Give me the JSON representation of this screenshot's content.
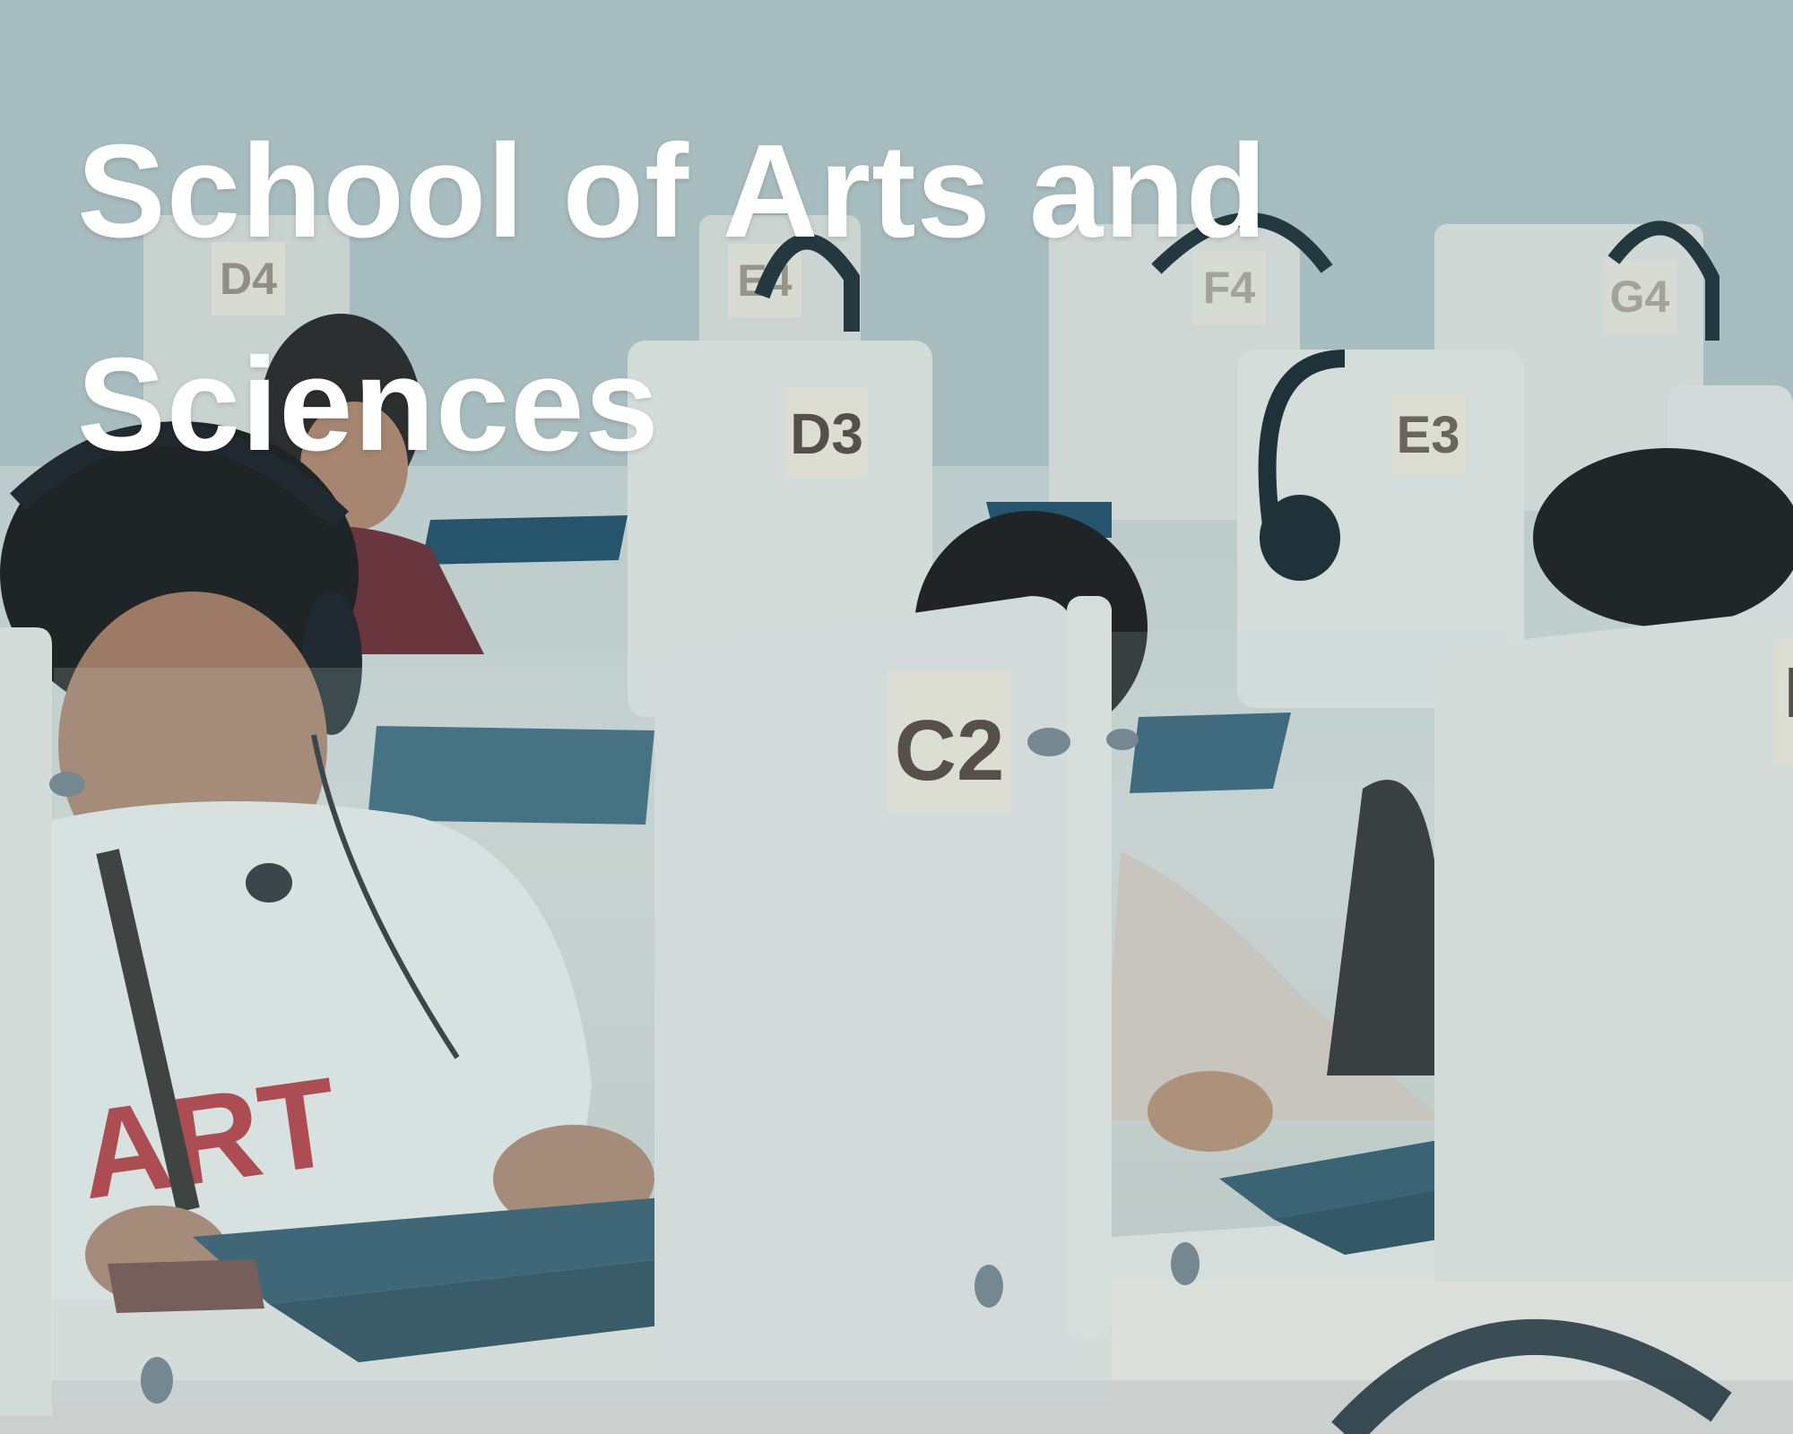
{
  "hero": {
    "title": "School of Arts and Sciences"
  },
  "booth_labels": {
    "c2": "C2",
    "d3": "D3",
    "e3": "E3",
    "d4": "D4",
    "e4": "E4",
    "f4": "F4",
    "g4": "G4",
    "d2": "D"
  },
  "shirt_text": "ART",
  "colors": {
    "title": "#ffffff",
    "divider": "#e4e6e2",
    "tablet": "#1f4a5e",
    "label_bg": "#efe9dc",
    "label_text": "#5b4a42"
  }
}
